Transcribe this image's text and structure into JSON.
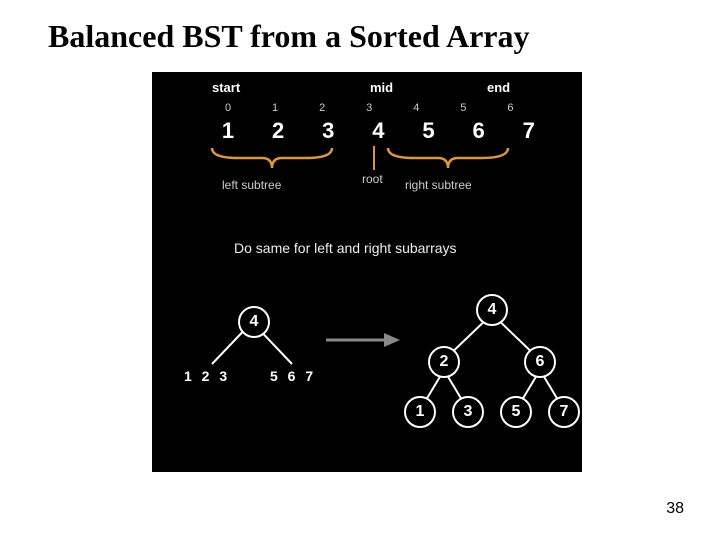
{
  "title": "Balanced BST from a Sorted Array",
  "page_number": "38",
  "pointers": {
    "start": "start",
    "mid": "mid",
    "end": "end"
  },
  "indices": [
    "0",
    "1",
    "2",
    "3",
    "4",
    "5",
    "6"
  ],
  "array": [
    "1",
    "2",
    "3",
    "4",
    "5",
    "6",
    "7"
  ],
  "labels": {
    "root": "root",
    "left_subtree": "left subtree",
    "right_subtree": "right subtree"
  },
  "caption": "Do same for left and right subarrays",
  "partial_tree": {
    "root": "4",
    "left_leaf_text": "1 2 3",
    "right_leaf_text": "5 6 7"
  },
  "full_tree": {
    "n4": "4",
    "n2": "2",
    "n6": "6",
    "n1": "1",
    "n3": "3",
    "n5": "5",
    "n7": "7"
  },
  "colors": {
    "brace": "#d9954a"
  }
}
